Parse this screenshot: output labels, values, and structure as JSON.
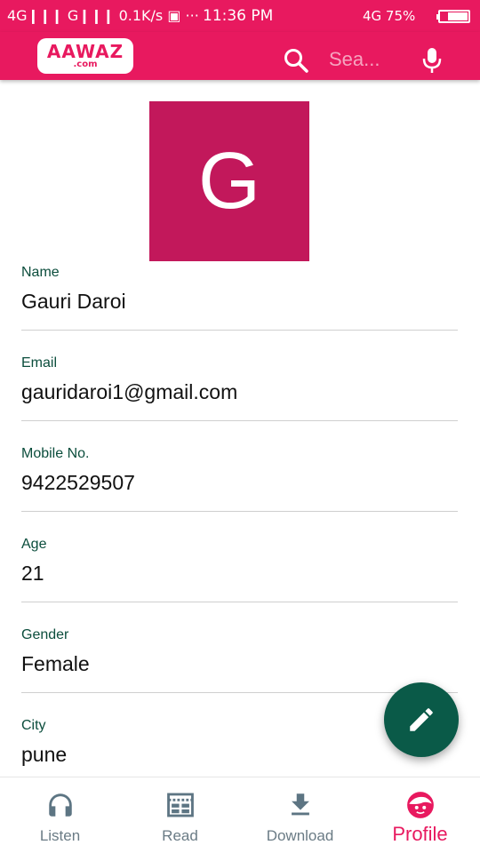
{
  "status_bar": {
    "left": "4G❙❙❙ G❙❙❙ 0.1K/s ▣ ···",
    "time": "11:36 PM",
    "right": "4G 75%",
    "battery_percent": 75
  },
  "app_bar": {
    "logo_main": "AAWAZ",
    "logo_sub": ".com",
    "search_placeholder": "Sea...",
    "search_icon": "search-icon",
    "mic_icon": "mic-icon"
  },
  "profile": {
    "avatar_letter": "G",
    "avatar_color": "#c2185b",
    "fields": [
      {
        "label": "Name",
        "value": "Gauri Daroi"
      },
      {
        "label": "Email",
        "value": "gauridaroi1@gmail.com"
      },
      {
        "label": "Mobile No.",
        "value": "9422529507"
      },
      {
        "label": "Age",
        "value": "21"
      },
      {
        "label": "Gender",
        "value": "Female"
      },
      {
        "label": "City",
        "value": "pune"
      }
    ]
  },
  "fab": {
    "icon": "pencil-icon",
    "color": "#0a5a48"
  },
  "bottom_nav": {
    "items": [
      {
        "label": "Listen",
        "icon": "headphones-icon"
      },
      {
        "label": "Read",
        "icon": "newspaper-icon"
      },
      {
        "label": "Download",
        "icon": "download-icon"
      },
      {
        "label": "Profile",
        "icon": "profile-face-icon",
        "active": true
      }
    ]
  },
  "colors": {
    "accent": "#e8195f",
    "label_green": "#0b4d3c",
    "inactive_nav": "#6a7b85"
  }
}
